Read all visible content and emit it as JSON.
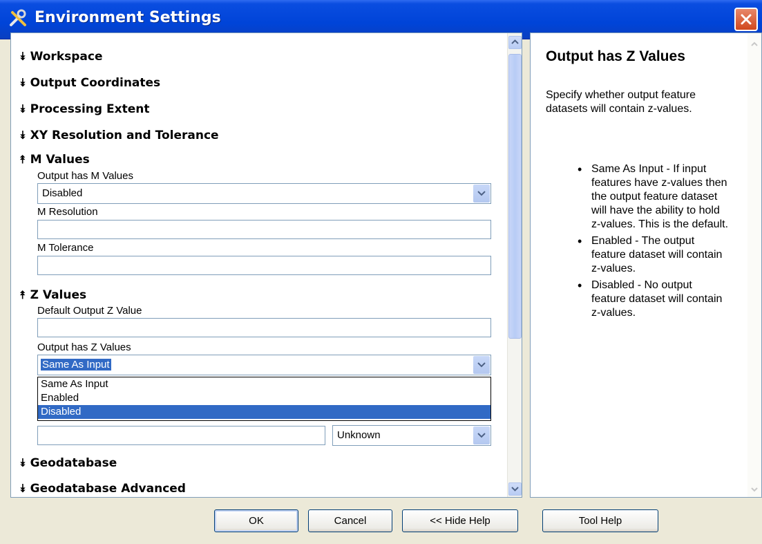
{
  "window": {
    "title": "Environment Settings",
    "icon": "tools-icon",
    "close_icon": "close-icon",
    "accent": "#0044d8"
  },
  "sections": {
    "workspace": "Workspace",
    "output_coordinates": "Output Coordinates",
    "processing_extent": "Processing Extent",
    "xy_resolution": "XY Resolution and Tolerance",
    "m_values": "M Values",
    "z_values": "Z Values",
    "geodatabase": "Geodatabase",
    "geodatabase_advanced": "Geodatabase Advanced"
  },
  "m_values": {
    "output_has_m_label": "Output has M Values",
    "output_has_m_value": "Disabled",
    "m_resolution_label": "M Resolution",
    "m_resolution_value": "",
    "m_tolerance_label": "M Tolerance",
    "m_tolerance_value": ""
  },
  "z_values": {
    "default_output_z_label": "Default Output Z Value",
    "default_output_z_value": "",
    "output_has_z_label": "Output has Z Values",
    "output_has_z_value": "Same As Input",
    "dropdown_options": [
      "Same As Input",
      "Enabled",
      "Disabled"
    ],
    "highlighted_option": "Disabled",
    "z_tolerance_value": "",
    "z_tolerance_unit": "Unknown"
  },
  "help": {
    "title": "Output has Z Values",
    "intro": "Specify whether output feature datasets will contain z-values.",
    "bullets": [
      "Same As Input - If input features have z-values then the output feature dataset will have the ability to hold z-values. This is the default.",
      "Enabled - The output feature dataset will contain z-values.",
      "Disabled - No output feature dataset will contain z-values."
    ]
  },
  "buttons": {
    "ok": "OK",
    "cancel": "Cancel",
    "hide_help": "<< Hide Help",
    "tool_help": "Tool Help"
  }
}
